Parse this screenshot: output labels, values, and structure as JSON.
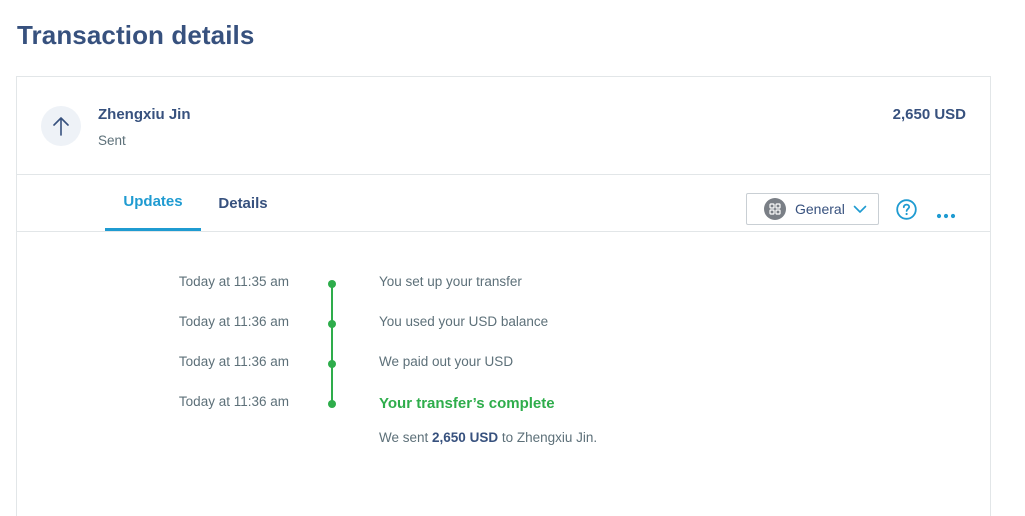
{
  "page": {
    "title": "Transaction details"
  },
  "transaction": {
    "recipient": "Zhengxiu Jin",
    "status": "Sent",
    "amount": "2,650 USD",
    "direction_icon": "arrow-up-icon"
  },
  "tabs": [
    {
      "label": "Updates",
      "active": true
    },
    {
      "label": "Details",
      "active": false
    }
  ],
  "toolbar": {
    "category_select": {
      "value": "General",
      "icon": "grid-icon"
    },
    "help_icon": "help-circle-icon",
    "more_icon": "more-horizontal-icon"
  },
  "timeline": [
    {
      "time": "Today at 11:35 am",
      "text": "You set up your transfer"
    },
    {
      "time": "Today at 11:36 am",
      "text": "You used your USD balance"
    },
    {
      "time": "Today at 11:36 am",
      "text": "We paid out your USD"
    },
    {
      "time": "Today at 11:36 am",
      "text": "Your transfer’s complete"
    }
  ],
  "completion_detail": {
    "prefix": "We sent ",
    "amount": "2,650 USD",
    "suffix": " to Zhengxiu Jin."
  },
  "colors": {
    "accent": "#1f9bd1",
    "success": "#2ead4b",
    "heading": "#37517e",
    "muted": "#5d7079"
  }
}
